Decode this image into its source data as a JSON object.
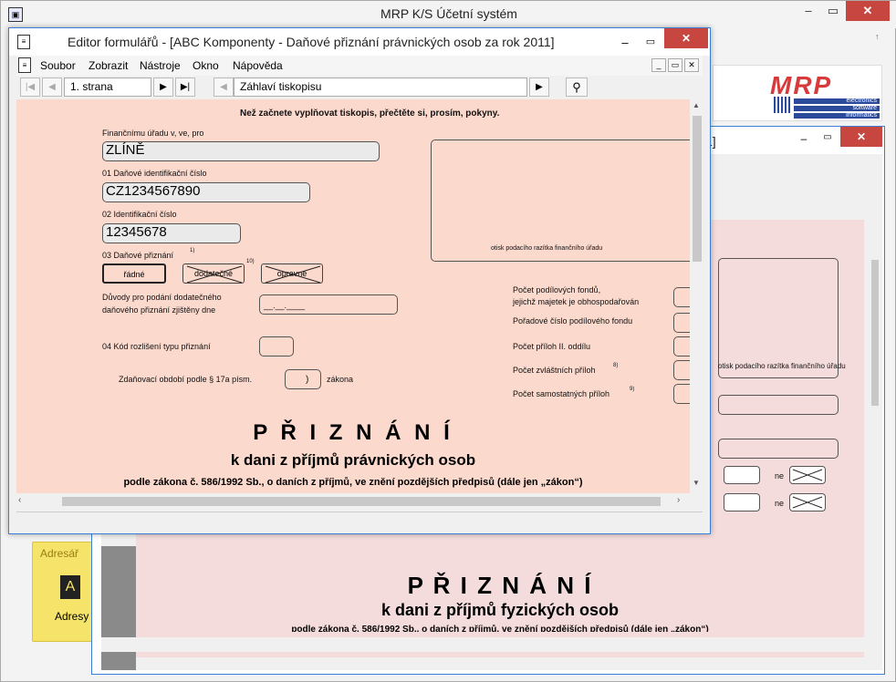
{
  "app": {
    "title": "MRP K/S Účetní systém",
    "logo_text": "MRP",
    "logo_lines": [
      "electronics",
      "software",
      "informatics"
    ],
    "tile_label": "Adresář",
    "tile_button": "Adresy"
  },
  "win2": {
    "title_fragment": "1]",
    "stamp_text": "otisk podacího razítka finančního úřadu",
    "heading": "P Ř I Z N Á N Í",
    "subheading": "k dani z příjmů fyzických osob",
    "law_line": "podle zákona č. 586/1992 Sb., o daních z příjmů, ve znění pozdějších předpisů (dále jen „zákon“)",
    "ne_label": "ne"
  },
  "editor": {
    "title": "Editor formulářů - [ABC Komponenty - Daňové přiznání právnických osob za rok 2011]",
    "menu": [
      "Soubor",
      "Zobrazit",
      "Nástroje",
      "Okno",
      "Nápověda"
    ],
    "page_select": "1. strana",
    "section_select": "Záhlaví tiskopisu"
  },
  "form": {
    "notice": "Než začnete vyplňovat tiskopis, přečtěte si, prosím, pokyny.",
    "office_label": "Finančnímu úřadu v, ve, pro",
    "office_value": "ZLÍNĚ",
    "dic_label": "01  Daňové identifikační číslo",
    "dic_value": "CZ1234567890",
    "ic_label": "02  Identifikační číslo",
    "ic_value": "12345678",
    "type_label": "03  Daňové přiznání",
    "type_sup": "1)",
    "type_options": [
      "řádné",
      "dodatečné",
      "opravné"
    ],
    "type_sup2": "10)",
    "reason_label_1": "Důvody pro podání dodatečného",
    "reason_label_2": "daňového přiznání zjištěny dne",
    "date_mask": "__.__.____",
    "kind_label": "04  Kód rozlišení typu přiznání",
    "period_label": "Zdaňovací období podle § 17a písm.",
    "period_suffix": "zákona",
    "period_paren": ")",
    "stamp_text": "otisk podacího razítka finančního úřadu",
    "right_labels": [
      {
        "text": "Počet podílových fondů,",
        "text2": "jejichž majetek je obhospodařován"
      },
      {
        "text": "Pořadové číslo podílového fondu",
        "text2": ""
      },
      {
        "text": "Počet příloh II. oddílu",
        "text2": ""
      },
      {
        "text": "Počet zvláštních příloh",
        "text2": "",
        "sup": "8)"
      },
      {
        "text": "Počet samostatných příloh",
        "text2": "",
        "sup": "9)"
      }
    ],
    "heading": "P Ř I Z N Á N Í",
    "subheading": "k dani z příjmů právnických osob",
    "law_line": "podle zákona č. 586/1992 Sb., o daních z příjmů, ve znění pozdějších předpisů (dále jen „zákon“)"
  }
}
